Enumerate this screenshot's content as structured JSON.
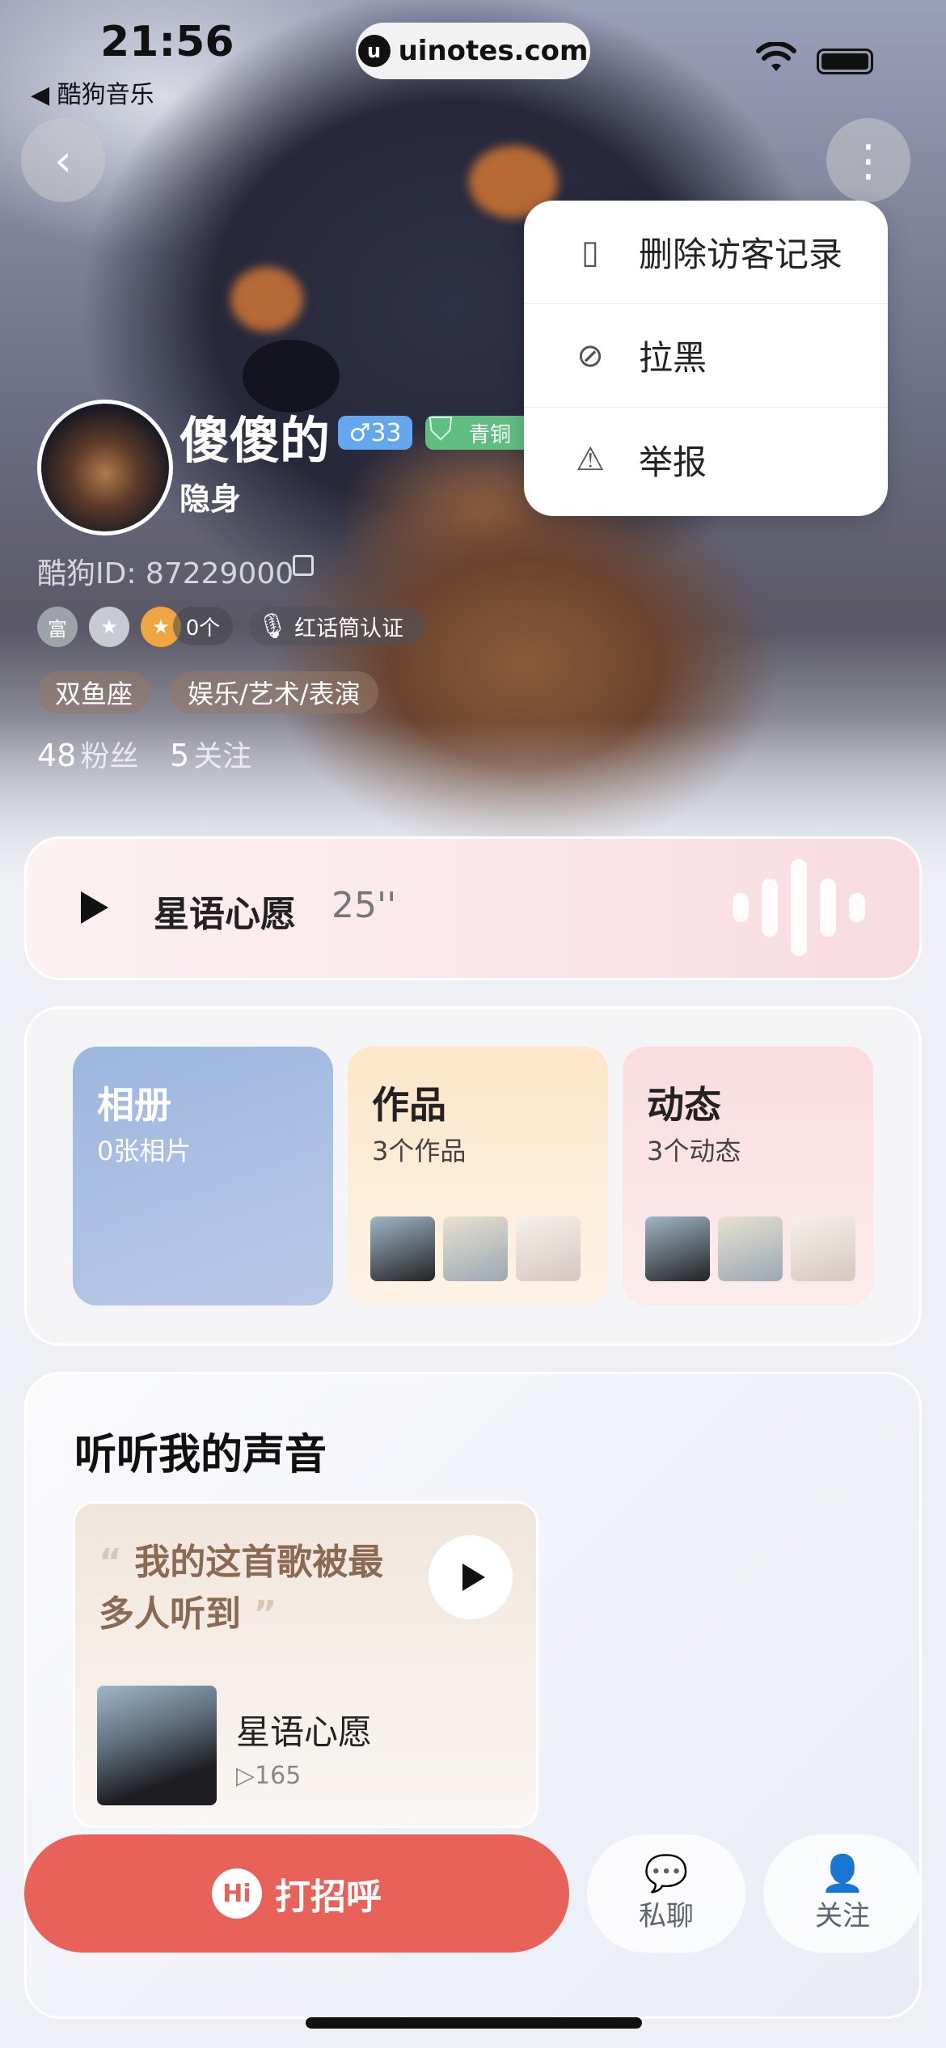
{
  "status_bar": {
    "time": "21:56",
    "back_app": "◀ 酷狗音乐",
    "url": "uinotes.com",
    "url_icon": "u"
  },
  "nav": {
    "back_icon": "‹",
    "more_icon": "⋮"
  },
  "menu": {
    "items": [
      {
        "label": "删除访客记录",
        "icon": "clipboard-icon",
        "glyph": "▯"
      },
      {
        "label": "拉黑",
        "icon": "block-icon",
        "glyph": "⊘"
      },
      {
        "label": "举报",
        "icon": "warning-icon",
        "glyph": "⚠"
      }
    ]
  },
  "profile": {
    "nickname": "傻傻的",
    "gender_age": "♂33",
    "level": "青铜",
    "status": "隐身",
    "id_text": "酷狗ID: 87229000",
    "badges": [
      {
        "label": "富",
        "color": "#9ea3aa"
      },
      {
        "label": "★",
        "color": "#c8ccd2"
      },
      {
        "label": "★",
        "color": "#f0a640"
      }
    ],
    "badge_count": "0个",
    "cert": "红话筒认证",
    "tags": [
      "双鱼座",
      "娱乐/艺术/表演"
    ],
    "fans_num": "48",
    "fans_label": "粉丝",
    "follow_num": "5",
    "follow_label": "关注"
  },
  "voice": {
    "title": "星语心愿",
    "duration": "25''"
  },
  "tiles": [
    {
      "title": "相册",
      "sub": "0张相片"
    },
    {
      "title": "作品",
      "sub": "3个作品"
    },
    {
      "title": "动态",
      "sub": "3个动态"
    }
  ],
  "listen": {
    "title": "听听我的声音",
    "quote_open": "“",
    "quote_text": "我的这首歌被最多人听到",
    "quote_close": "”",
    "song_name": "星语心愿",
    "song_plays": "▷165"
  },
  "actions": {
    "greet": "打招呼",
    "greet_icon": "Hi",
    "chat": "私聊",
    "follow": "关注"
  },
  "colors": {
    "accent": "#e9625a",
    "age_badge": "#63a8ef",
    "level_badge": "#5fbf80"
  }
}
